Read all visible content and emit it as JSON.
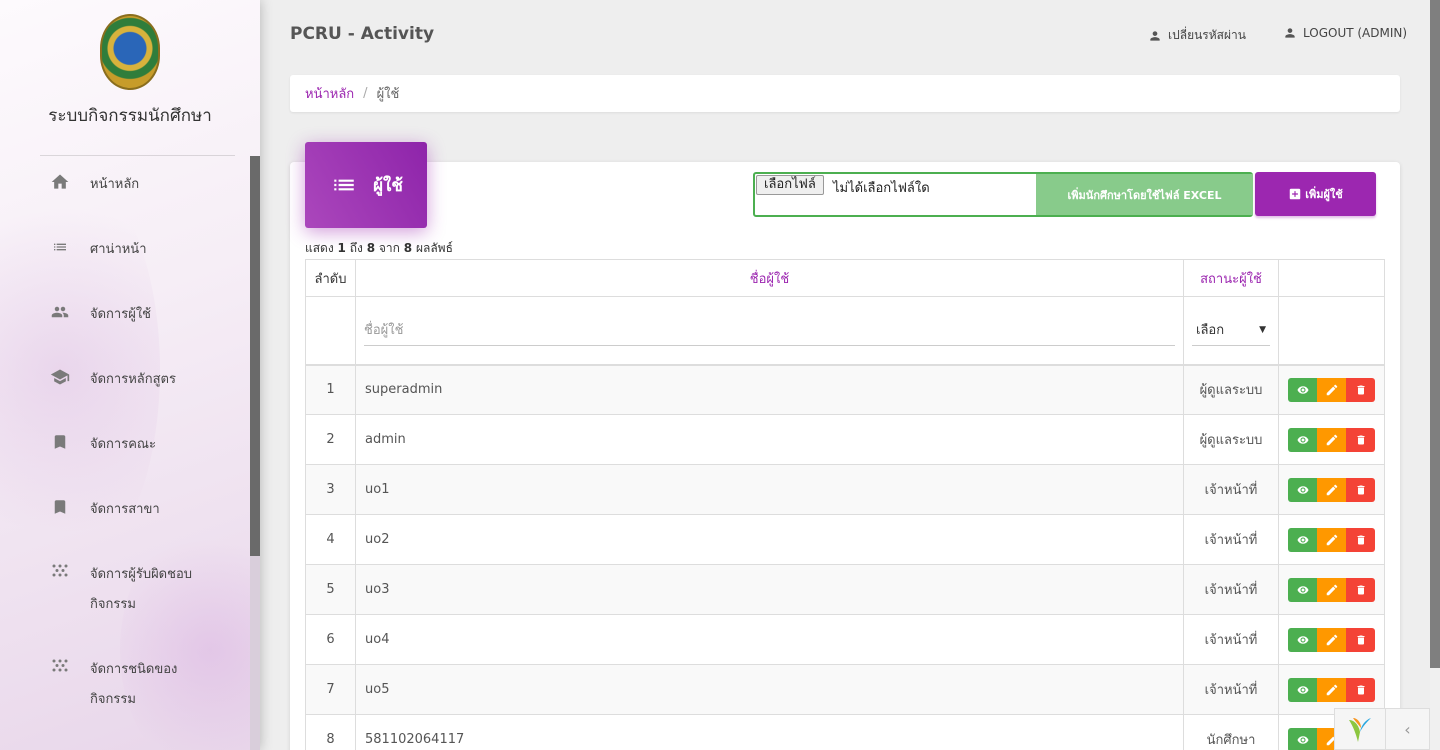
{
  "sidebar": {
    "brand": "ระบบกิจกรรมนักศึกษา",
    "items": [
      {
        "label": "หน้าหลัก",
        "icon": "home-icon"
      },
      {
        "label": "ศาน่าหน้า",
        "icon": "list-icon"
      },
      {
        "label": "จัดการผู้ใช้",
        "icon": "people-icon"
      },
      {
        "label": "จัดการหลักสูตร",
        "icon": "school-icon"
      },
      {
        "label": "จัดการคณะ",
        "icon": "bookmark-icon"
      },
      {
        "label": "จัดการสาขา",
        "icon": "bookmark-icon"
      },
      {
        "label": "จัดการผู้รับผิดชอบกิจกรรม",
        "line1": "จัดการผู้รับผิดชอบ",
        "line2": "กิจกรรม",
        "icon": "dots-icon"
      },
      {
        "label": "จัดการชนิดของกิจกรรม",
        "line1": "จัดการชนิดของ",
        "line2": "กิจกรรม",
        "icon": "dots-icon"
      }
    ]
  },
  "header": {
    "title": "PCRU - Activity",
    "change_password": "เปลี่ยนรหัสผ่าน",
    "logout": "LOGOUT (ADMIN)"
  },
  "breadcrumb": {
    "home": "หน้าหลัก",
    "separator": "/",
    "current": "ผู้ใช้"
  },
  "card": {
    "title": "ผู้ใช้",
    "file_button": "เลือกไฟล์",
    "file_status": "ไม่ได้เลือกไฟล์ใด",
    "excel_button": "เพิ่มนักศึกษาโดยใช้ไฟล์ EXCEL",
    "add_button": "เพิ่มผู้ใช้"
  },
  "summary": {
    "prefix": "แสดง",
    "from": "1",
    "to_word": "ถึง",
    "to": "8",
    "of_word": "จาก",
    "total": "8",
    "suffix": "ผลลัพธ์"
  },
  "table": {
    "headers": {
      "seq": "ลำดับ",
      "name": "ชื่อผู้ใช้",
      "status": "สถานะผู้ใช้"
    },
    "filter": {
      "name_placeholder": "ชื่อผู้ใช้",
      "status_select": "เลือก"
    },
    "rows": [
      {
        "seq": "1",
        "name": "superadmin",
        "status": "ผู้ดูแลระบบ"
      },
      {
        "seq": "2",
        "name": "admin",
        "status": "ผู้ดูแลระบบ"
      },
      {
        "seq": "3",
        "name": "uo1",
        "status": "เจ้าหน้าที่"
      },
      {
        "seq": "4",
        "name": "uo2",
        "status": "เจ้าหน้าที่"
      },
      {
        "seq": "5",
        "name": "uo3",
        "status": "เจ้าหน้าที่"
      },
      {
        "seq": "6",
        "name": "uo4",
        "status": "เจ้าหน้าที่"
      },
      {
        "seq": "7",
        "name": "uo5",
        "status": "เจ้าหน้าที่"
      },
      {
        "seq": "8",
        "name": "581102064117",
        "status": "นักศึกษา"
      }
    ]
  },
  "colors": {
    "primary": "#9c27b0",
    "success": "#4caf50",
    "warning": "#ff9800",
    "danger": "#f44336"
  }
}
